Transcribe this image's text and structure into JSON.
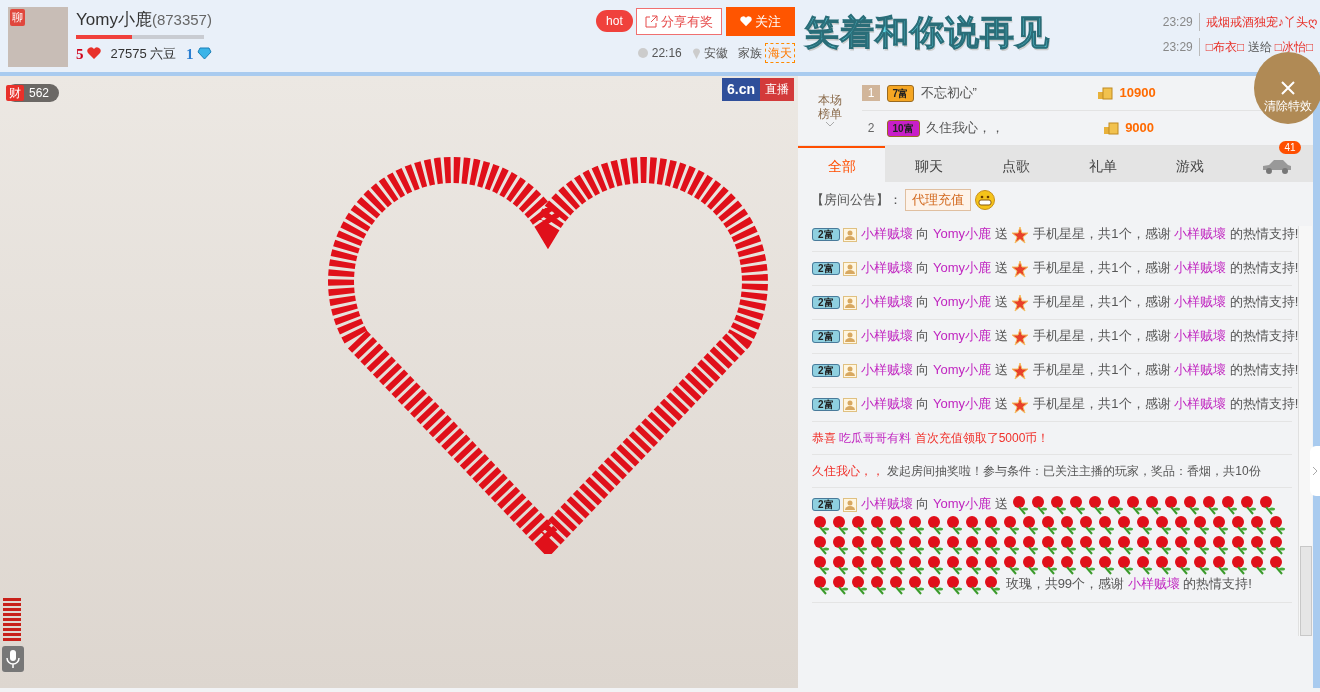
{
  "streamer": {
    "avatar_badge": "聊",
    "name": "Yomy小鹿",
    "room_id": "(873357)",
    "level": 0.44,
    "hearts": "5",
    "beans": "27575 六豆",
    "diamonds": "1"
  },
  "actions": {
    "hot": "hot",
    "share": "分享有奖",
    "follow": "关注"
  },
  "meta": {
    "time": "22:16",
    "location": "安徽",
    "family_label": "家族",
    "family": "海天"
  },
  "banner": "笑着和你说再见",
  "ticker": [
    {
      "time": "23:29",
      "parts": [
        {
          "text": "戒烟戒酒独宠♪丫头ღ",
          "kind": "user"
        }
      ]
    },
    {
      "time": "23:29",
      "parts": [
        {
          "text": "□布衣□",
          "kind": "user"
        },
        {
          "text": "送给",
          "kind": "text"
        },
        {
          "text": "□冰怡□",
          "kind": "user"
        }
      ]
    }
  ],
  "video": {
    "wealth_badge": "财",
    "viewers": "562",
    "logo": "6.cn",
    "live": "直播"
  },
  "clear_effects": "清除特效",
  "ranking": {
    "title": "本场榜单",
    "rows": [
      {
        "rank": "1",
        "highlighted": true,
        "rich_level": "7富",
        "color": "#f5a623",
        "name": "不忘初心”",
        "coins": "10900"
      },
      {
        "rank": "2",
        "highlighted": false,
        "rich_level": "10富",
        "color": "#c81ec8",
        "name": "久住我心，，",
        "coins": "9000"
      }
    ]
  },
  "tabs": [
    {
      "label": "全部",
      "selected": true
    },
    {
      "label": "聊天",
      "selected": false
    },
    {
      "label": "点歌",
      "selected": false
    },
    {
      "label": "礼单",
      "selected": false
    },
    {
      "label": "游戏",
      "selected": false
    }
  ],
  "car_count": "41",
  "announcement": {
    "label": "【房间公告】：",
    "link": "代理充值"
  },
  "messages": [
    {
      "kind": "gift",
      "rich_level": "2富",
      "sender": "小样贼壞",
      "to": "向",
      "receiver": "Yomy小鹿",
      "send": "送",
      "item": "手机星星，共1个，感谢",
      "thanks": "小样贼壞",
      "tail": "的热情支持!"
    },
    {
      "kind": "gift",
      "rich_level": "2富",
      "sender": "小样贼壞",
      "to": "向",
      "receiver": "Yomy小鹿",
      "send": "送",
      "item": "手机星星，共1个，感谢",
      "thanks": "小样贼壞",
      "tail": "的热情支持!"
    },
    {
      "kind": "gift",
      "rich_level": "2富",
      "sender": "小样贼壞",
      "to": "向",
      "receiver": "Yomy小鹿",
      "send": "送",
      "item": "手机星星，共1个，感谢",
      "thanks": "小样贼壞",
      "tail": "的热情支持!"
    },
    {
      "kind": "gift",
      "rich_level": "2富",
      "sender": "小样贼壞",
      "to": "向",
      "receiver": "Yomy小鹿",
      "send": "送",
      "item": "手机星星，共1个，感谢",
      "thanks": "小样贼壞",
      "tail": "的热情支持!"
    },
    {
      "kind": "gift",
      "rich_level": "2富",
      "sender": "小样贼壞",
      "to": "向",
      "receiver": "Yomy小鹿",
      "send": "送",
      "item": "手机星星，共1个，感谢",
      "thanks": "小样贼壞",
      "tail": "的热情支持!"
    },
    {
      "kind": "gift",
      "rich_level": "2富",
      "sender": "小样贼壞",
      "to": "向",
      "receiver": "Yomy小鹿",
      "send": "送",
      "item": "手机星星，共1个，感谢",
      "thanks": "小样贼壞",
      "tail": "的热情支持!"
    },
    {
      "kind": "notice",
      "parts": [
        {
          "text": "恭喜",
          "kind": "alert"
        },
        {
          "text": "吃瓜哥哥有料",
          "kind": "user"
        },
        {
          "text": "首次充值领取了5000币！",
          "kind": "alert"
        }
      ]
    },
    {
      "kind": "notice",
      "parts": [
        {
          "text": "久住我心，，",
          "kind": "alert"
        },
        {
          "text": "发起房间抽奖啦！参与条件：已关注主播的玩家，奖品：香烟，共10份",
          "kind": "text"
        }
      ]
    },
    {
      "kind": "roses",
      "rich_level": "2富",
      "sender": "小样贼壞",
      "to": "向",
      "receiver": "Yomy小鹿",
      "send": "送",
      "item": "玫瑰，共99个，感谢",
      "thanks": "小样贼壞",
      "tail": "的热情支持!"
    }
  ]
}
